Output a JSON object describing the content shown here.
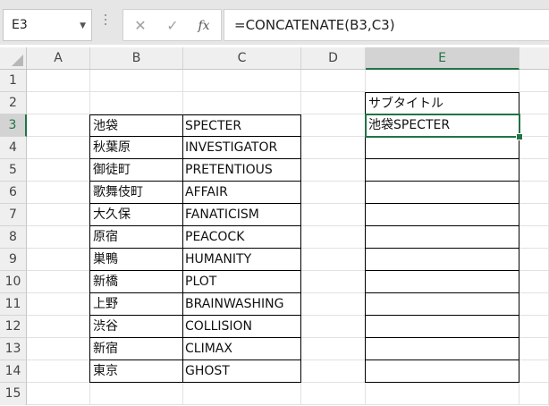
{
  "formula_bar": {
    "name_box": "E3",
    "cancel_glyph": "✕",
    "enter_glyph": "✓",
    "fx_label": "fx",
    "formula": "=CONCATENATE(B3,C3)"
  },
  "columns": [
    "A",
    "B",
    "C",
    "D",
    "E"
  ],
  "active_column": "E",
  "rows": [
    "1",
    "2",
    "3",
    "4",
    "5",
    "6",
    "7",
    "8",
    "9",
    "10",
    "11",
    "12",
    "13",
    "14",
    "15"
  ],
  "active_row": "3",
  "cells": {
    "E2": "サブタイトル",
    "E3": "池袋SPECTER"
  },
  "table": [
    {
      "b": "池袋",
      "c": "SPECTER"
    },
    {
      "b": "秋葉原",
      "c": "INVESTIGATOR"
    },
    {
      "b": "御徒町",
      "c": "PRETENTIOUS"
    },
    {
      "b": "歌舞伎町",
      "c": "AFFAIR"
    },
    {
      "b": "大久保",
      "c": "FANATICISM"
    },
    {
      "b": "原宿",
      "c": "PEACOCK"
    },
    {
      "b": "巣鴨",
      "c": "HUMANITY"
    },
    {
      "b": "新橋",
      "c": "PLOT"
    },
    {
      "b": "上野",
      "c": "BRAINWASHING"
    },
    {
      "b": "渋谷",
      "c": "COLLISION"
    },
    {
      "b": "新宿",
      "c": "CLIMAX"
    },
    {
      "b": "東京",
      "c": "GHOST"
    }
  ],
  "colors": {
    "accent": "#217346",
    "header_bg": "#efefef",
    "gridline": "#e1e1e1"
  }
}
